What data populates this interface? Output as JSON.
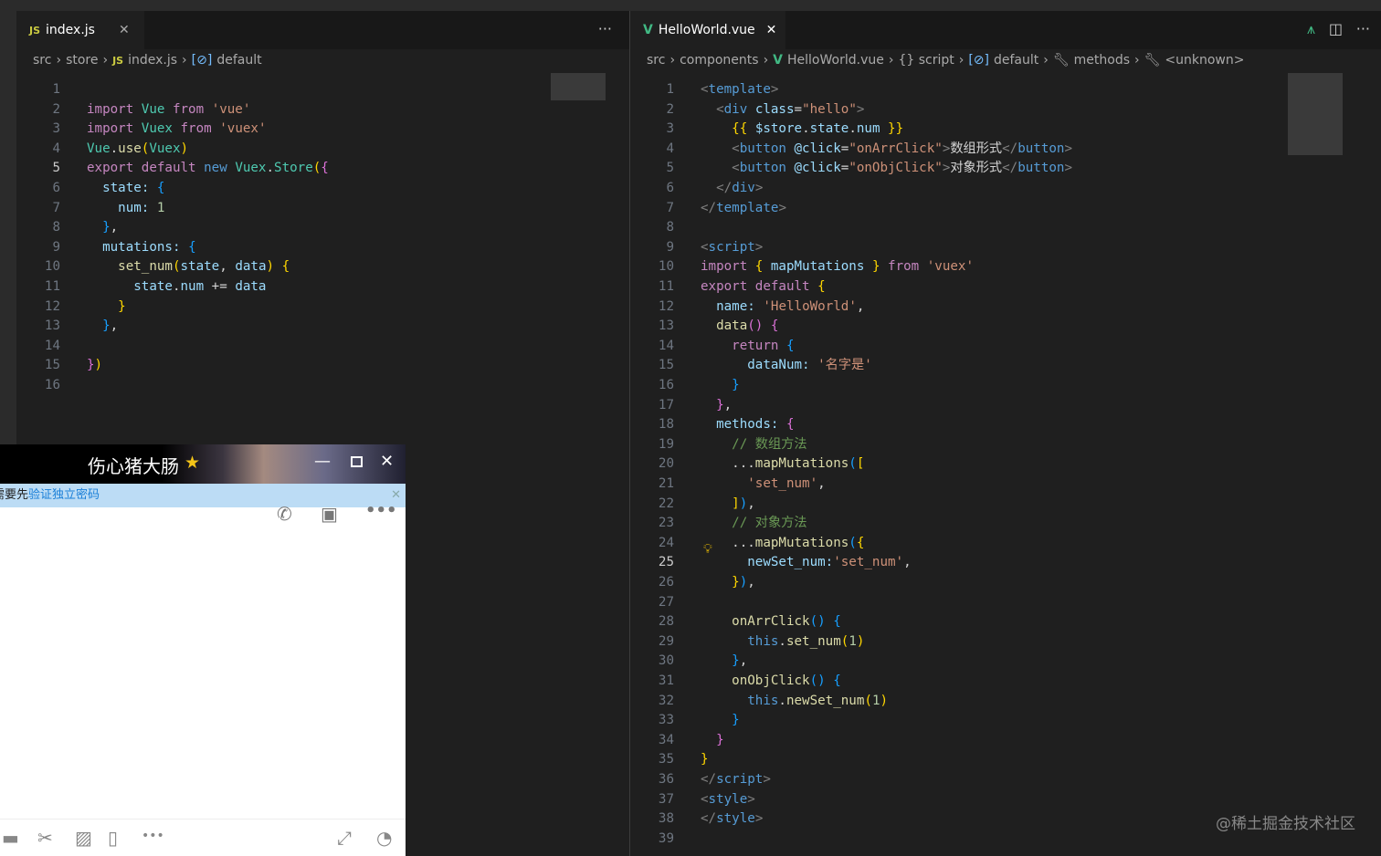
{
  "left_editor": {
    "tab": {
      "label": "index.js",
      "icon": "js-icon"
    },
    "breadcrumbs": [
      "src",
      "store",
      "index.js",
      "default"
    ],
    "current_line": 5,
    "lines": [
      [],
      [
        [
          "p",
          "import"
        ],
        [
          "w",
          " "
        ],
        [
          "c",
          "Vue"
        ],
        [
          "w",
          " "
        ],
        [
          "p",
          "from"
        ],
        [
          "w",
          " "
        ],
        [
          "s",
          "'vue'"
        ]
      ],
      [
        [
          "p",
          "import"
        ],
        [
          "w",
          " "
        ],
        [
          "c",
          "Vuex"
        ],
        [
          "w",
          " "
        ],
        [
          "p",
          "from"
        ],
        [
          "w",
          " "
        ],
        [
          "s",
          "'vuex'"
        ]
      ],
      [
        [
          "c",
          "Vue"
        ],
        [
          "w",
          "."
        ],
        [
          "f",
          "use"
        ],
        [
          "y",
          "("
        ],
        [
          "c",
          "Vuex"
        ],
        [
          "y",
          ")"
        ]
      ],
      [
        [
          "p",
          "export"
        ],
        [
          "w",
          " "
        ],
        [
          "p",
          "default"
        ],
        [
          "w",
          " "
        ],
        [
          "k",
          "new"
        ],
        [
          "w",
          " "
        ],
        [
          "c",
          "Vuex"
        ],
        [
          "w",
          "."
        ],
        [
          "c",
          "Store"
        ],
        [
          "y",
          "("
        ],
        [
          "pk",
          "{"
        ]
      ],
      [
        [
          "w",
          "  "
        ],
        [
          "v",
          "state"
        ],
        [
          "v",
          ": "
        ],
        [
          "b",
          "{"
        ]
      ],
      [
        [
          "w",
          "    "
        ],
        [
          "v",
          "num"
        ],
        [
          "v",
          ": "
        ],
        [
          "n",
          "1"
        ]
      ],
      [
        [
          "w",
          "  "
        ],
        [
          "b",
          "}"
        ],
        [
          "w",
          ","
        ]
      ],
      [
        [
          "w",
          "  "
        ],
        [
          "v",
          "mutations"
        ],
        [
          "v",
          ": "
        ],
        [
          "b",
          "{"
        ]
      ],
      [
        [
          "w",
          "    "
        ],
        [
          "f",
          "set_num"
        ],
        [
          "y",
          "("
        ],
        [
          "v",
          "state"
        ],
        [
          "w",
          ", "
        ],
        [
          "v",
          "data"
        ],
        [
          "y",
          ")"
        ],
        [
          "w",
          " "
        ],
        [
          "y",
          "{"
        ]
      ],
      [
        [
          "w",
          "      "
        ],
        [
          "v",
          "state"
        ],
        [
          "w",
          "."
        ],
        [
          "v",
          "num"
        ],
        [
          "w",
          " += "
        ],
        [
          "v",
          "data"
        ]
      ],
      [
        [
          "w",
          "    "
        ],
        [
          "y",
          "}"
        ]
      ],
      [
        [
          "w",
          "  "
        ],
        [
          "b",
          "}"
        ],
        [
          "w",
          ","
        ]
      ],
      [],
      [
        [
          "pk",
          "}"
        ],
        [
          "y",
          ")"
        ]
      ],
      []
    ]
  },
  "right_editor": {
    "tab": {
      "label": "HelloWorld.vue",
      "icon": "vue-icon"
    },
    "breadcrumbs": [
      "src",
      "components",
      "HelloWorld.vue",
      "{} script",
      "default",
      "methods",
      "<unknown>"
    ],
    "current_line": 25,
    "lines": [
      [
        [
          "t",
          "<"
        ],
        [
          "tn",
          "template"
        ],
        [
          "t",
          ">"
        ]
      ],
      [
        [
          "w",
          "  "
        ],
        [
          "t",
          "<"
        ],
        [
          "tn",
          "div"
        ],
        [
          "w",
          " "
        ],
        [
          "v",
          "class"
        ],
        [
          "w",
          "="
        ],
        [
          "s",
          "\"hello\""
        ],
        [
          "t",
          ">"
        ]
      ],
      [
        [
          "w",
          "    "
        ],
        [
          "y",
          "{{"
        ],
        [
          "w",
          " "
        ],
        [
          "v",
          "$store"
        ],
        [
          "w",
          "."
        ],
        [
          "v",
          "state"
        ],
        [
          "w",
          "."
        ],
        [
          "v",
          "num"
        ],
        [
          "w",
          " "
        ],
        [
          "y",
          "}}"
        ]
      ],
      [
        [
          "w",
          "    "
        ],
        [
          "t",
          "<"
        ],
        [
          "tn",
          "button"
        ],
        [
          "w",
          " "
        ],
        [
          "v",
          "@click"
        ],
        [
          "w",
          "="
        ],
        [
          "s",
          "\"onArrClick\""
        ],
        [
          "t",
          ">"
        ],
        [
          "w",
          "数组形式"
        ],
        [
          "t",
          "</"
        ],
        [
          "tn",
          "button"
        ],
        [
          "t",
          ">"
        ]
      ],
      [
        [
          "w",
          "    "
        ],
        [
          "t",
          "<"
        ],
        [
          "tn",
          "button"
        ],
        [
          "w",
          " "
        ],
        [
          "v",
          "@click"
        ],
        [
          "w",
          "="
        ],
        [
          "s",
          "\"onObjClick\""
        ],
        [
          "t",
          ">"
        ],
        [
          "w",
          "对象形式"
        ],
        [
          "t",
          "</"
        ],
        [
          "tn",
          "button"
        ],
        [
          "t",
          ">"
        ]
      ],
      [
        [
          "w",
          "  "
        ],
        [
          "t",
          "</"
        ],
        [
          "tn",
          "div"
        ],
        [
          "t",
          ">"
        ]
      ],
      [
        [
          "t",
          "</"
        ],
        [
          "tn",
          "template"
        ],
        [
          "t",
          ">"
        ]
      ],
      [],
      [
        [
          "t",
          "<"
        ],
        [
          "tn",
          "script"
        ],
        [
          "t",
          ">"
        ]
      ],
      [
        [
          "p",
          "import"
        ],
        [
          "w",
          " "
        ],
        [
          "y",
          "{"
        ],
        [
          "w",
          " "
        ],
        [
          "v",
          "mapMutations"
        ],
        [
          "w",
          " "
        ],
        [
          "y",
          "}"
        ],
        [
          "w",
          " "
        ],
        [
          "p",
          "from"
        ],
        [
          "w",
          " "
        ],
        [
          "s",
          "'vuex'"
        ]
      ],
      [
        [
          "p",
          "export"
        ],
        [
          "w",
          " "
        ],
        [
          "p",
          "default"
        ],
        [
          "w",
          " "
        ],
        [
          "y",
          "{"
        ]
      ],
      [
        [
          "w",
          "  "
        ],
        [
          "v",
          "name"
        ],
        [
          "v",
          ": "
        ],
        [
          "s",
          "'HelloWorld'"
        ],
        [
          "w",
          ","
        ]
      ],
      [
        [
          "w",
          "  "
        ],
        [
          "f",
          "data"
        ],
        [
          "pk",
          "()"
        ],
        [
          "w",
          " "
        ],
        [
          "pk",
          "{"
        ]
      ],
      [
        [
          "w",
          "    "
        ],
        [
          "p",
          "return"
        ],
        [
          "w",
          " "
        ],
        [
          "b",
          "{"
        ]
      ],
      [
        [
          "w",
          "      "
        ],
        [
          "v",
          "dataNum"
        ],
        [
          "v",
          ": "
        ],
        [
          "s",
          "'名字是'"
        ]
      ],
      [
        [
          "w",
          "    "
        ],
        [
          "b",
          "}"
        ]
      ],
      [
        [
          "w",
          "  "
        ],
        [
          "pk",
          "}"
        ],
        [
          "w",
          ","
        ]
      ],
      [
        [
          "w",
          "  "
        ],
        [
          "v",
          "methods"
        ],
        [
          "v",
          ": "
        ],
        [
          "pk",
          "{"
        ]
      ],
      [
        [
          "w",
          "    "
        ],
        [
          "cm",
          "// 数组方法"
        ]
      ],
      [
        [
          "w",
          "    "
        ],
        [
          "w",
          "..."
        ],
        [
          "f",
          "mapMutations"
        ],
        [
          "b",
          "("
        ],
        [
          "y",
          "["
        ]
      ],
      [
        [
          "w",
          "      "
        ],
        [
          "s",
          "'set_num'"
        ],
        [
          "w",
          ","
        ]
      ],
      [
        [
          "w",
          "    "
        ],
        [
          "y",
          "]"
        ],
        [
          "b",
          ")"
        ],
        [
          "w",
          ","
        ]
      ],
      [
        [
          "w",
          "    "
        ],
        [
          "cm",
          "// 对象方法"
        ]
      ],
      [
        [
          "w",
          "    "
        ],
        [
          "w",
          "..."
        ],
        [
          "f",
          "mapMutations"
        ],
        [
          "b",
          "("
        ],
        [
          "y",
          "{"
        ]
      ],
      [
        [
          "w",
          "      "
        ],
        [
          "v",
          "newSet_num"
        ],
        [
          "v",
          ":"
        ],
        [
          "s",
          "'set_num'"
        ],
        [
          "w",
          ","
        ]
      ],
      [
        [
          "w",
          "    "
        ],
        [
          "y",
          "}"
        ],
        [
          "b",
          ")"
        ],
        [
          "w",
          ","
        ]
      ],
      [],
      [
        [
          "w",
          "    "
        ],
        [
          "f",
          "onArrClick"
        ],
        [
          "b",
          "()"
        ],
        [
          "w",
          " "
        ],
        [
          "b",
          "{"
        ]
      ],
      [
        [
          "w",
          "      "
        ],
        [
          "k",
          "this"
        ],
        [
          "w",
          "."
        ],
        [
          "f",
          "set_num"
        ],
        [
          "y",
          "("
        ],
        [
          "n",
          "1"
        ],
        [
          "y",
          ")"
        ]
      ],
      [
        [
          "w",
          "    "
        ],
        [
          "b",
          "}"
        ],
        [
          "w",
          ","
        ]
      ],
      [
        [
          "w",
          "    "
        ],
        [
          "f",
          "onObjClick"
        ],
        [
          "b",
          "()"
        ],
        [
          "w",
          " "
        ],
        [
          "b",
          "{"
        ]
      ],
      [
        [
          "w",
          "      "
        ],
        [
          "k",
          "this"
        ],
        [
          "w",
          "."
        ],
        [
          "f",
          "newSet_num"
        ],
        [
          "y",
          "("
        ],
        [
          "n",
          "1"
        ],
        [
          "y",
          ")"
        ]
      ],
      [
        [
          "w",
          "    "
        ],
        [
          "b",
          "}"
        ]
      ],
      [
        [
          "w",
          "  "
        ],
        [
          "pk",
          "}"
        ]
      ],
      [
        [
          "y",
          "}"
        ]
      ],
      [
        [
          "t",
          "</"
        ],
        [
          "tn",
          "script"
        ],
        [
          "t",
          ">"
        ]
      ],
      [
        [
          "t",
          "<"
        ],
        [
          "tn",
          "style"
        ],
        [
          "t",
          ">"
        ]
      ],
      [
        [
          "t",
          "</"
        ],
        [
          "tn",
          "style"
        ],
        [
          "t",
          ">"
        ]
      ],
      []
    ]
  },
  "qq_window": {
    "title": "伤心猪大肠",
    "notice_prefix": "需要先",
    "notice_link": "验证独立密码"
  },
  "watermark": "@稀土掘金技术社区"
}
